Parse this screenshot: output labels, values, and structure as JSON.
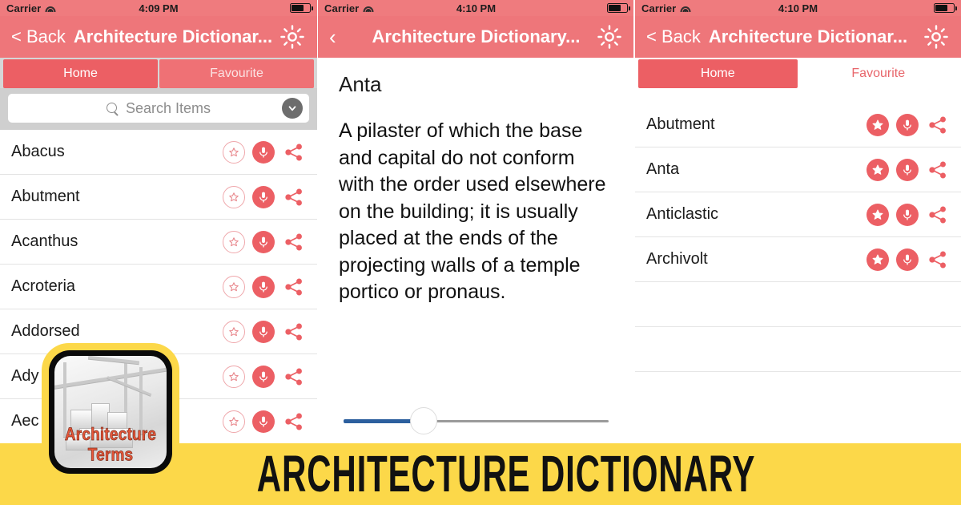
{
  "banner": {
    "title": "ARCHITECTURE DICTIONARY",
    "background_color": "#fcd849",
    "text_color": "#111111"
  },
  "app_icon": {
    "label": "Architecture Terms",
    "border_color": "#0a0a0a",
    "backdrop_color": "#fcd849"
  },
  "theme": {
    "accent_pink": "#ec5f64",
    "navbar_pink": "#ee767a",
    "statusbar_pink": "#ef7b7e",
    "search_tray_gray": "#cfcfcf",
    "tab_tray_gray": "#d6d6d6"
  },
  "panels": [
    {
      "id": "home-list",
      "status_bar": {
        "carrier": "Carrier",
        "time": "4:09 PM",
        "wifi_icon": "wifi-icon",
        "battery_icon": "battery-icon"
      },
      "nav": {
        "back_label": "< Back",
        "title": "Architecture Dictionar...",
        "settings_icon": "gear-icon"
      },
      "tabs": [
        {
          "label": "Home",
          "selected": true
        },
        {
          "label": "Favourite",
          "selected": false
        }
      ],
      "search": {
        "placeholder": "Search Items",
        "value": "",
        "search_icon": "search-icon",
        "dropdown_icon": "chevron-down-icon"
      },
      "rows": [
        {
          "term": "Abacus",
          "favourited": false
        },
        {
          "term": "Abutment",
          "favourited": false
        },
        {
          "term": "Acanthus",
          "favourited": false
        },
        {
          "term": "Acroteria",
          "favourited": false
        },
        {
          "term": "Addorsed",
          "favourited": false
        },
        {
          "term": "Ady",
          "favourited": false
        },
        {
          "term": "Aec",
          "favourited": false
        }
      ],
      "row_icons": {
        "favourite": "star-outline-icon",
        "speak": "microphone-icon",
        "share": "share-icon"
      }
    },
    {
      "id": "term-detail",
      "status_bar": {
        "carrier": "Carrier",
        "time": "4:10 PM",
        "wifi_icon": "wifi-icon",
        "battery_icon": "battery-icon"
      },
      "nav": {
        "back_label": "",
        "back_icon": "chevron-left-icon",
        "title": "Architecture Dictionary...",
        "settings_icon": "gear-icon"
      },
      "detail": {
        "term": "Anta",
        "definition": "A pilaster of which the base and capital do not conform with the order used elsewhere on the building; it is usually placed at the ends of the projecting walls of a temple portico or pronaus."
      },
      "slider": {
        "name": "speech-rate-slider",
        "fill_color": "#2c5f9e",
        "track_color": "#9b9b9b",
        "value_percent": 26
      }
    },
    {
      "id": "favourite-list",
      "status_bar": {
        "carrier": "Carrier",
        "time": "4:10 PM",
        "wifi_icon": "wifi-icon",
        "battery_icon": "battery-icon"
      },
      "nav": {
        "back_label": "< Back",
        "title": "Architecture Dictionar...",
        "settings_icon": "gear-icon"
      },
      "tabs": [
        {
          "label": "Home",
          "selected": false
        },
        {
          "label": "Favourite",
          "selected": true
        }
      ],
      "rows": [
        {
          "term": "Abutment",
          "favourited": true
        },
        {
          "term": "Anta",
          "favourited": true
        },
        {
          "term": "Anticlastic",
          "favourited": true
        },
        {
          "term": "Archivolt",
          "favourited": true
        }
      ],
      "row_icons": {
        "favourite": "star-filled-icon",
        "speak": "microphone-icon",
        "share": "share-icon"
      }
    }
  ]
}
